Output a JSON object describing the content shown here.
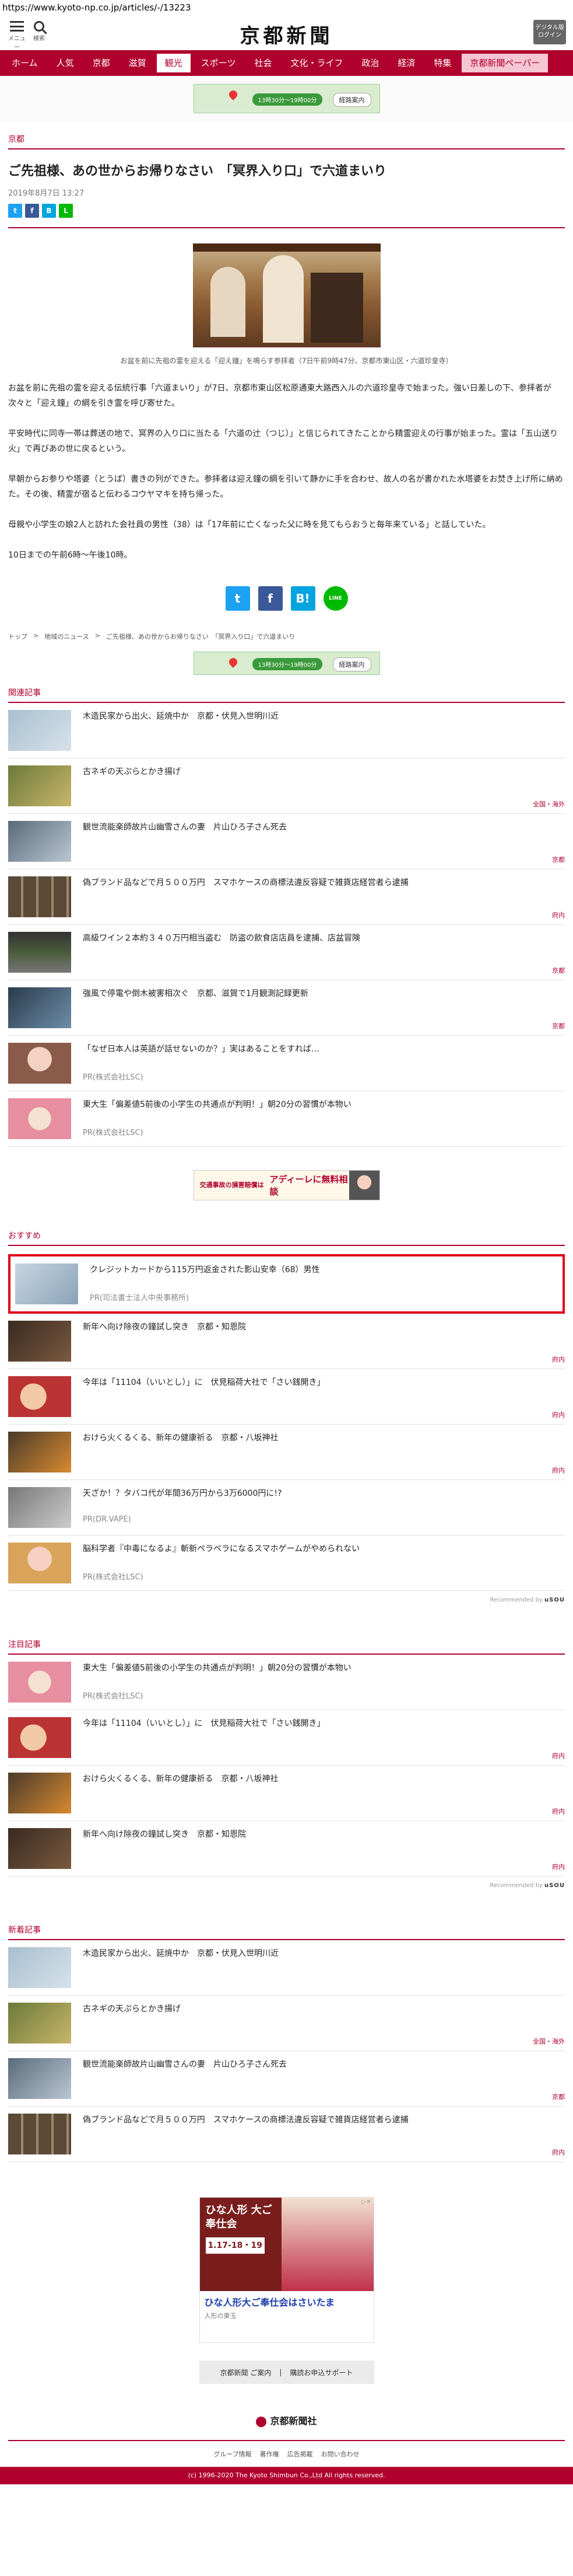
{
  "url": "https://www.kyoto-np.co.jp/articles/-/13223",
  "header": {
    "menu_label": "メニュー",
    "search_label": "検索",
    "logo": "京都新聞",
    "digital_label": "デジタル版ログイン"
  },
  "nav": [
    "ホーム",
    "人気",
    "京都",
    "滋賀",
    "観光",
    "スポーツ",
    "社会",
    "文化・ライフ",
    "政治",
    "経済",
    "特集",
    "京都新聞ペーパー"
  ],
  "ad_map": {
    "pill": "13時30分〜19時00分",
    "button": "経路案内"
  },
  "article": {
    "category": "京都",
    "title": "ご先祖様、あの世からお帰りなさい　「冥界入り口」で六道まいり",
    "date": "2019年8月7日 13:27",
    "caption": "お盆を前に先祖の霊を迎える「迎え鐘」を鳴らす参拝者（7日午前9時47分、京都市東山区・六道珍皇寺）",
    "paragraphs": [
      "お盆を前に先祖の霊を迎える伝統行事「六道まいり」が7日、京都市東山区松原通東大路西入ルの六道珍皇寺で始まった。強い日差しの下、参拝者が次々と「迎え鐘」の綱を引き霊を呼び寄せた。",
      "平安時代に同寺一帯は葬送の地で、冥界の入り口に当たる「六道の辻（つじ）」と信じられてきたことから精霊迎えの行事が始まった。霊は「五山送り火」で再びあの世に戻るという。",
      "早朝からお参りや塔婆（とうば）書きの列ができた。参拝者は迎え鐘の綱を引いて静かに手を合わせ、故人の名が書かれた水塔婆をお焚き上げ所に納めた。その後、精霊が宿ると伝わるコウヤマキを持ち帰った。",
      "母親や小学生の娘2人と訪れた会社員の男性（38）は「17年前に亡くなった父に時を見てもらおうと毎年来ている」と話していた。",
      "10日までの午前6時〜午後10時。"
    ],
    "share_big": [
      "t",
      "f",
      "B!",
      "LINE"
    ],
    "breadcrumb": [
      "トップ",
      "地域のニュース",
      "ご先祖様、あの世からお帰りなさい　「冥界入り口」で六道まいり"
    ]
  },
  "related": {
    "label": "関連記事",
    "items": [
      {
        "title": "木造民家から出火、延焼中か　京都・伏見入世明川近",
        "tag": ""
      },
      {
        "title": "古ネギの天ぷらとかき揚げ",
        "tag": "全国・海外"
      },
      {
        "title": "観世流能楽師故片山幽雪さんの妻　片山ひろ子さん死去",
        "tag": "京都"
      },
      {
        "title": "偽ブランド品などで月５００万円　スマホケースの商標法違反容疑で雑貨店経営者ら逮捕",
        "tag": "府内"
      },
      {
        "title": "高級ワイン２本約３４０万円相当盗む　防盗の飲食店店員を逮捕、店盆冒険",
        "tag": "京都"
      },
      {
        "title": "強風で停電や倒木被害相次ぐ　京都、滋賀で1月観測記録更新",
        "tag": "京都"
      },
      {
        "title": "「なぜ日本人は英語が話せないのか？」実はあることをすれば…",
        "sub": "PR(株式会社LSC)",
        "tag": ""
      },
      {
        "title": "東大生「偏差値5前後の小学生の共通点が判明！」朝20分の習慣が本物い",
        "sub": "PR(株式会社LSC)",
        "tag": ""
      }
    ]
  },
  "banner_ad": {
    "left": "交通事故の損害賠償は",
    "main": "アディーレに無料相談"
  },
  "recommend": {
    "label": "おすすめ",
    "items": [
      {
        "title": "クレジットカードから115万円返金された影山安幸（68）男性",
        "sub": "PR(司法書士法人中央事務所)",
        "tag": ""
      },
      {
        "title": "新年へ向け除夜の鐘試し突き　京都・知恩院",
        "tag": "府内"
      },
      {
        "title": "今年は「11104（いいとし）」に　伏見稲荷大社で「さい銭開き」",
        "tag": "府内"
      },
      {
        "title": "おけら火くるくる、新年の健康祈る　京都・八坂神社",
        "tag": "府内"
      },
      {
        "title": "天ざか！？タバコ代が年間36万円から3万6000円に!?",
        "sub": "PR(DR.VAPE)",
        "tag": ""
      },
      {
        "title": "脳科学者『中毒になるよ』斬新ペラペラになるスマホゲームがやめられない",
        "sub": "PR(株式会社LSC)",
        "tag": ""
      }
    ],
    "recommended_by": "Recommended by",
    "brand": "uSOU"
  },
  "attention": {
    "label": "注目記事",
    "items": [
      {
        "title": "東大生「偏差値5前後の小学生の共通点が判明！」朝20分の習慣が本物い",
        "sub": "PR(株式会社LSC)",
        "tag": ""
      },
      {
        "title": "今年は「11104（いいとし）」に　伏見稲荷大社で「さい銭開き」",
        "tag": "府内"
      },
      {
        "title": "おけら火くるくる、新年の健康祈る　京都・八坂神社",
        "tag": "府内"
      },
      {
        "title": "新年へ向け除夜の鐘試し突き　京都・知恩院",
        "tag": "府内"
      }
    ],
    "recommended_by": "Recommended by",
    "brand": "uSOU"
  },
  "latest": {
    "label": "新着記事",
    "items": [
      {
        "title": "木造民家から出火、延焼中か　京都・伏見入世明川近",
        "tag": ""
      },
      {
        "title": "古ネギの天ぷらとかき揚げ",
        "tag": "全国・海外"
      },
      {
        "title": "観世流能楽師故片山幽雪さんの妻　片山ひろ子さん死去",
        "tag": "京都"
      },
      {
        "title": "偽ブランド品などで月５００万円　スマホケースの商標法違反容疑で雑貨店経営者ら逮捕",
        "tag": "府内"
      }
    ]
  },
  "big_ad": {
    "left": "ひな人形 大ご奉仕会",
    "date": "1.17-18・19",
    "title": "ひな人形大ご奉仕会はさいたま",
    "sub": "人形の東玉"
  },
  "footer": {
    "links": [
      "京都新聞 ご案内",
      "購読お申込サポート"
    ],
    "logo": "京都新聞社",
    "nav": [
      "グループ情報",
      "著作権",
      "広告掲載",
      "お問い合わせ"
    ],
    "copyright": "(c) 1996-2020 The Kyoto Shimbun Co.,Ltd All rights reserved."
  }
}
